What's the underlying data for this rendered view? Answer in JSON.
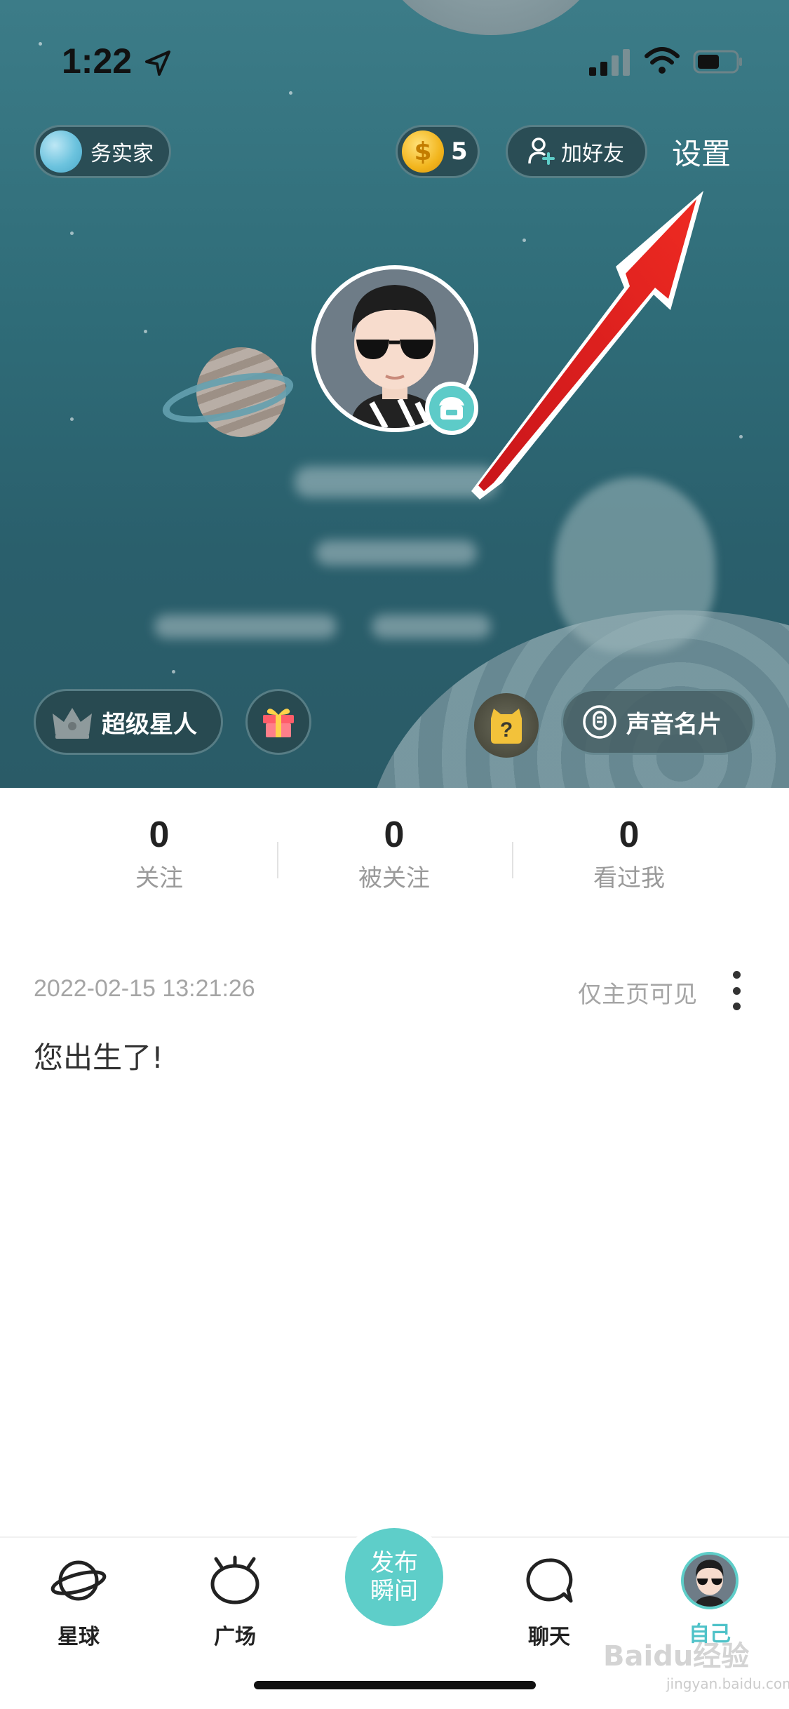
{
  "status_bar": {
    "time": "1:22"
  },
  "header": {
    "user_planet_label": "务实家",
    "coins": "5",
    "add_friend_label": "加好友",
    "settings_label": "设置"
  },
  "hero_buttons": {
    "vip_label": "超级星人",
    "voice_card_label": "声音名片"
  },
  "stats": [
    {
      "value": "0",
      "label": "关注"
    },
    {
      "value": "0",
      "label": "被关注"
    },
    {
      "value": "0",
      "label": "看过我"
    }
  ],
  "post": {
    "timestamp": "2022-02-15 13:21:26",
    "visibility": "仅主页可见",
    "text": "您出生了!"
  },
  "tabbar": {
    "items": [
      {
        "label": "星球",
        "icon": "planet-icon"
      },
      {
        "label": "广场",
        "icon": "square-icon"
      },
      {
        "label": "聊天",
        "icon": "chat-icon"
      },
      {
        "label": "自己",
        "icon": "avatar"
      }
    ],
    "publish_line1": "发布",
    "publish_line2": "瞬间",
    "active_index": 3
  },
  "watermark": {
    "brand": "Baidu经验",
    "url": "jingyan.baidu.com"
  },
  "colors": {
    "hero_bg": "#2f6c78",
    "accent": "#5ecec9",
    "arrow": "#e0191c"
  }
}
